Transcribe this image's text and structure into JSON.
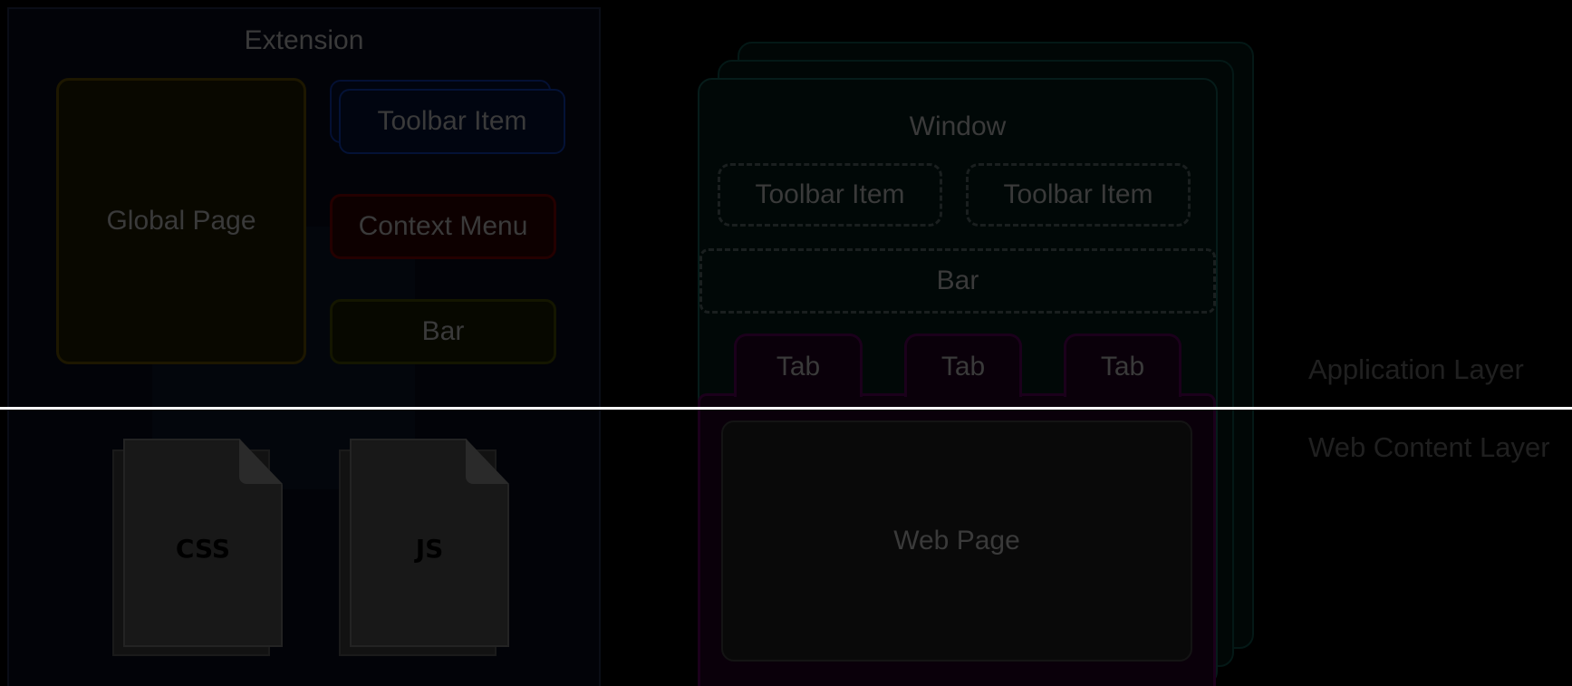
{
  "extension": {
    "title": "Extension",
    "global_page": "Global Page",
    "toolbar_item": "Toolbar Item",
    "context_menu": "Context Menu",
    "bar": "Bar",
    "files": [
      "CSS",
      "JS"
    ]
  },
  "window": {
    "title": "Window",
    "toolbar_items": [
      "Toolbar Item",
      "Toolbar Item"
    ],
    "bar": "Bar",
    "tabs": [
      "Tab",
      "Tab",
      "Tab"
    ],
    "web_page": "Web Page"
  },
  "layers": {
    "application": "Application Layer",
    "web_content": "Web Content Layer"
  },
  "colors": {
    "background": "#000000",
    "divider": "#ffffff",
    "global_page_border": "#1d1700",
    "toolbar_item_border": "#041236",
    "context_menu_border": "#240000",
    "bar_border": "#141600",
    "window_border": "#061c1a",
    "tab_border": "#1b001b"
  }
}
